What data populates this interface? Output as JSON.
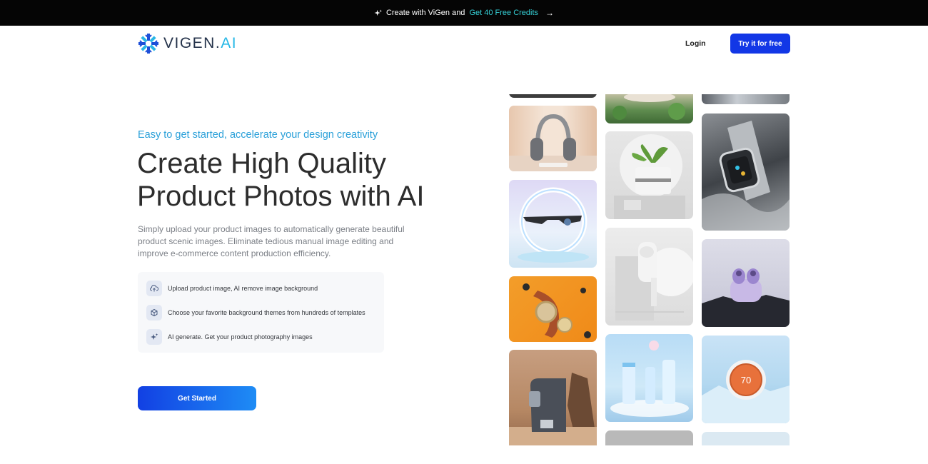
{
  "announcement": {
    "text_prefix": "Create with ViGen and ",
    "highlight": "Get 40 Free Credits"
  },
  "nav": {
    "logo_word": "VIGEN.",
    "logo_suffix": "AI",
    "login": "Login",
    "try_free": "Try it for free"
  },
  "hero": {
    "eyebrow": "Easy to get started, accelerate your design creativity",
    "headline_line1": "Create High Quality",
    "headline_line2": "Product Photos with AI",
    "description": "Simply upload your product images to automatically generate beautiful product scenic images. Eliminate tedious manual image editing and improve e-commerce content production efficiency.",
    "steps": [
      {
        "icon": "cloud-upload-icon",
        "label": "Upload product image, AI remove image background"
      },
      {
        "icon": "cube-icon",
        "label": "Choose your favorite background themes from hundreds of templates"
      },
      {
        "icon": "sparkle-icon",
        "label": "AI generate. Get your product photography images"
      }
    ],
    "cta": "Get Started"
  },
  "gallery": {
    "thermostat_reading": "70"
  },
  "colors": {
    "accent": "#1237e6",
    "eyebrow": "#2aa0d9",
    "highlight": "#35d0d6"
  }
}
